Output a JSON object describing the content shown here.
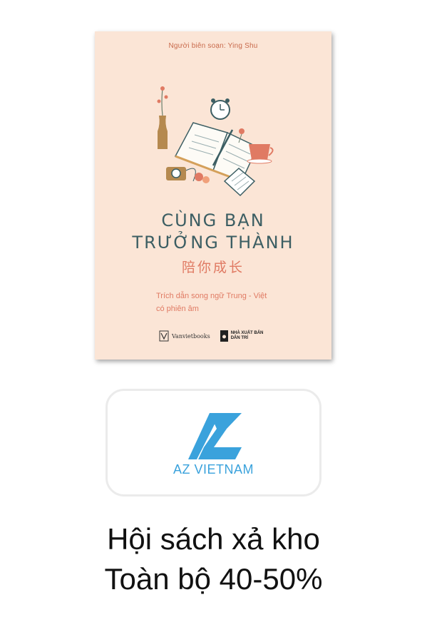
{
  "book": {
    "compiler": "Người biên soạn: Ying Shu",
    "title_line1": "CÙNG BẠN",
    "title_line2": "TRƯỞNG THÀNH",
    "chinese_title": "陪你成长",
    "subtitle_line1": "Trích dẫn song ngữ Trung - Việt",
    "subtitle_line2": "có phiên âm",
    "publisher1": "Vanvietbooks",
    "publisher2_line1": "NHÀ XUẤT BẢN",
    "publisher2_line2": "DÂN TRÍ"
  },
  "brand": {
    "name": "AZ VIETNAM",
    "color": "#3aa2dc"
  },
  "promo": {
    "line1": "Hội sách xả kho",
    "line2": "Toàn bộ 40-50%"
  },
  "colors": {
    "cover_bg": "#fbe5d6",
    "title": "#3c5e63",
    "accent": "#e07a63"
  }
}
